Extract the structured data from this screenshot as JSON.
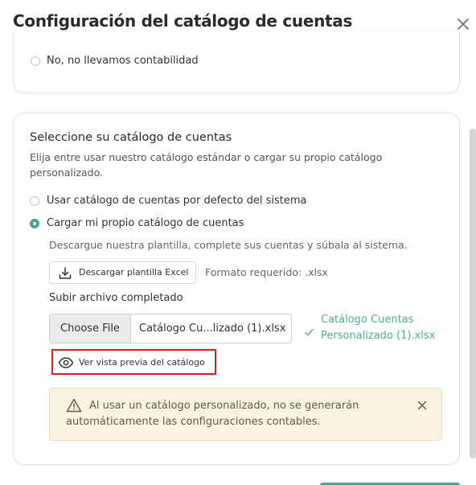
{
  "dialog": {
    "title": "Configuración del catálogo de cuentas",
    "close_icon": "close-icon"
  },
  "accounting_option": {
    "label": "No, no llevamos contabilidad",
    "checked": false
  },
  "catalog_section": {
    "title": "Seleccione su catálogo de cuentas",
    "description_line1": "Elija entre usar nuestro catálogo estándar o cargar su propio catálogo",
    "description_line2": "personalizado.",
    "options": [
      {
        "label": "Usar catálogo de cuentas por defecto del sistema",
        "checked": false
      },
      {
        "label": "Cargar mi propio catálogo de cuentas",
        "checked": true
      }
    ],
    "instructions": "Descargue nuestra plantilla, complete sus cuentas y súbala al sistema.",
    "download_button": "Descargar plantilla Excel",
    "format_note": "Formato requerido: .xlsx",
    "upload_label": "Subir archivo completado",
    "file_input": {
      "button_label": "Choose File",
      "file_name": "Catálogo Cu...lizado (1).xlsx"
    },
    "success_message_line1": "Catálogo Cuentas",
    "success_message_line2": "Personalizado (1).xlsx",
    "preview_button": "Ver vista previa del catálogo",
    "alert": {
      "line1": "Al usar un catálogo personalizado, no se generarán",
      "line2": "automáticamente las configuraciones contables.",
      "icon": "warning-icon"
    }
  },
  "colors": {
    "accent": "#4aa39a",
    "success": "#4fae8f",
    "alert_bg": "#fcf2e2",
    "highlight_border": "#e21b1b"
  }
}
